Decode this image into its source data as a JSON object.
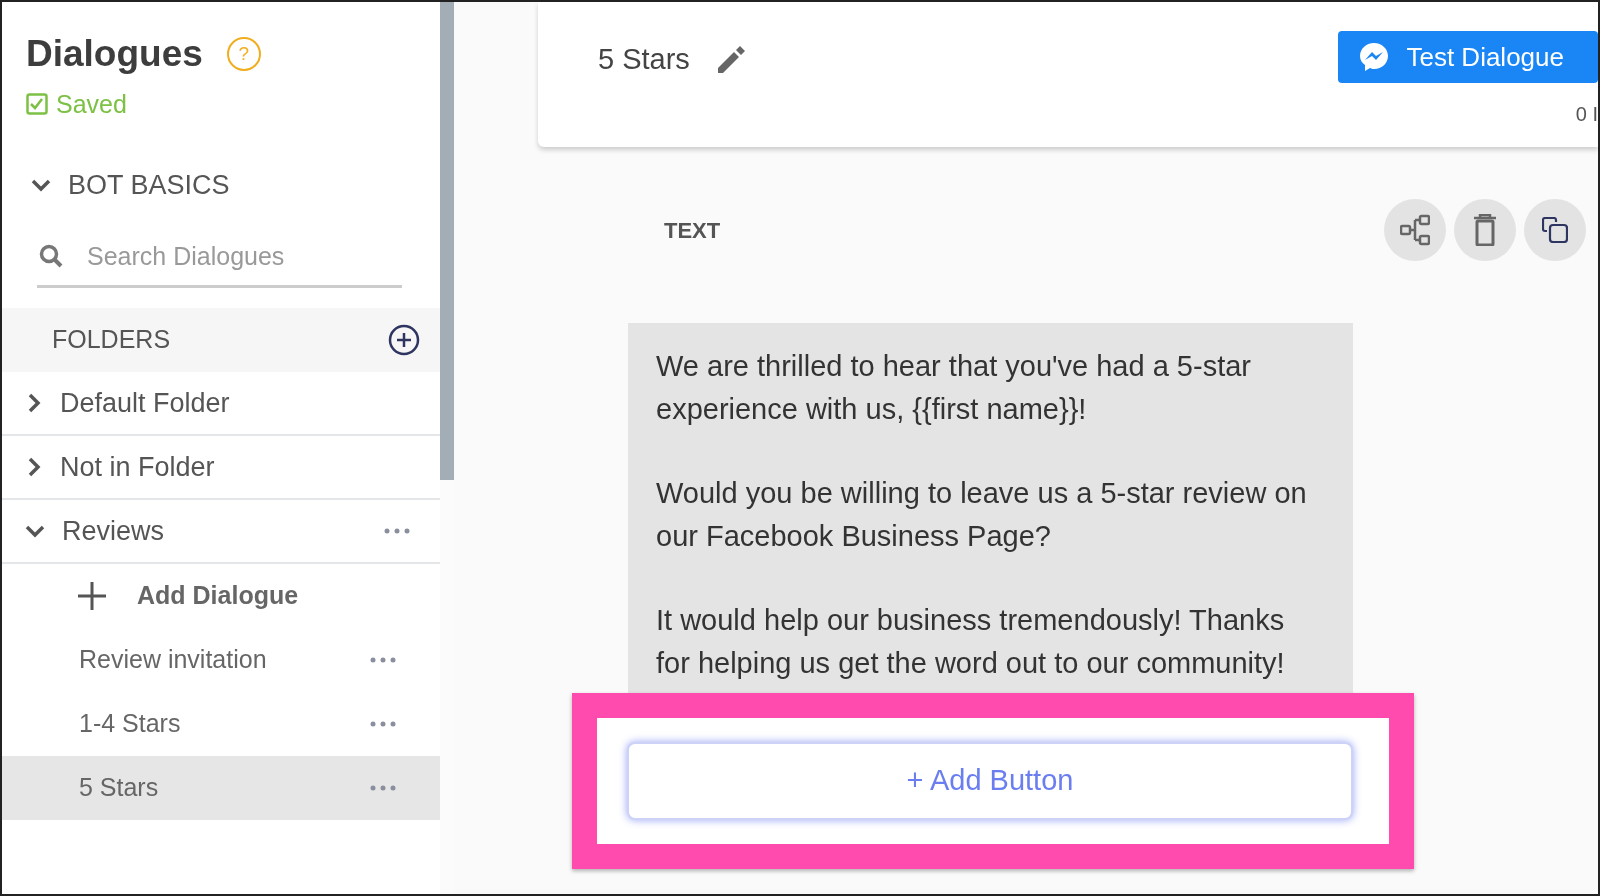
{
  "sidebar": {
    "title": "Dialogues",
    "help": "?",
    "save_status": "Saved",
    "section": {
      "label": "BOT BASICS",
      "expanded": true
    },
    "search": {
      "placeholder": "Search Dialogues"
    },
    "folders_header": "FOLDERS",
    "folders": [
      {
        "label": "Default Folder",
        "expanded": false
      },
      {
        "label": "Not in Folder",
        "expanded": false
      },
      {
        "label": "Reviews",
        "expanded": true,
        "add_label": "Add Dialogue",
        "children": [
          {
            "label": "Review invitation",
            "selected": false
          },
          {
            "label": "1-4 Stars",
            "selected": false
          },
          {
            "label": "5 Stars",
            "selected": true
          }
        ]
      }
    ]
  },
  "header": {
    "title": "5 Stars",
    "test_button": "Test Dialogue",
    "counter": "0 I"
  },
  "block": {
    "type_label": "TEXT",
    "message": [
      "We are thrilled to hear that you've had a 5-star experience with us, {{first name}}!",
      "Would you be willing to leave us a 5-star review on our Facebook Business Page?",
      "It would help our business tremendously! Thanks for helping us get the word out to our community!"
    ],
    "add_button": "+ Add Button",
    "highlighted": true
  }
}
